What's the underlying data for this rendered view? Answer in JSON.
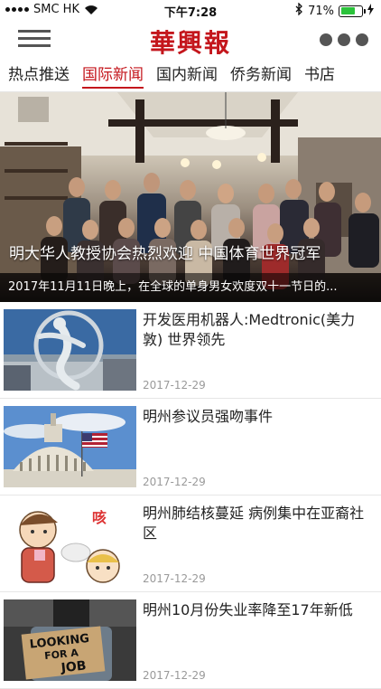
{
  "status_bar": {
    "carrier": "SMC HK",
    "time": "下午7:28",
    "battery": "71%",
    "battery_level": 0.71
  },
  "header": {
    "logo": "華興報",
    "logo_color": "#c4161c",
    "menu_icon": "hamburger-menu-icon",
    "more_icon": "more-dots-icon"
  },
  "tabs": [
    {
      "label": "热点推送",
      "active": false
    },
    {
      "label": "国际新闻",
      "active": true
    },
    {
      "label": "国内新闻",
      "active": false
    },
    {
      "label": "侨务新闻",
      "active": false
    },
    {
      "label": "书店",
      "active": false
    }
  ],
  "hero": {
    "title": "明大华人教授协会热烈欢迎 中国体育世界冠军",
    "caption": "2017年11月11日晚上，在全球的单身男女欢度双十一节日的..."
  },
  "articles": [
    {
      "title": "开发医用机器人:Medtronic(美力敦) 世界领先",
      "date": "2017-12-29",
      "thumb": "sculpture-photo"
    },
    {
      "title": "明州参议员强吻事件",
      "date": "2017-12-29",
      "thumb": "capitol-photo"
    },
    {
      "title": "明州肺结核蔓延 病例集中在亚裔社区",
      "date": "2017-12-29",
      "thumb": "cartoon-cough-photo"
    },
    {
      "title": "明州10月份失业率降至17年新低",
      "date": "2017-12-29",
      "thumb": "looking-for-job-photo"
    }
  ],
  "thumb_texts": {
    "cough": "咳",
    "sign_line1": "LOOKING",
    "sign_line2": "FOR A",
    "sign_line3": "JOB"
  }
}
